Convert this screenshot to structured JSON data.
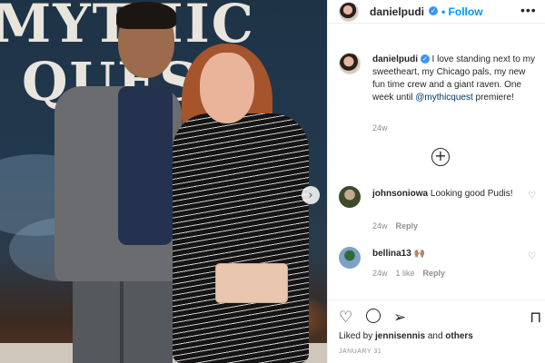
{
  "photo": {
    "poster_line1": "MYTHIC",
    "poster_line2": "QUEST",
    "next_glyph": "›"
  },
  "header": {
    "username": "danielpudi",
    "verified_glyph": "✓",
    "dot": "•",
    "follow_label": "Follow",
    "more_glyph": "•••"
  },
  "caption": {
    "username": "danielpudi",
    "text": " I love standing next to my sweetheart, my Chicago pals, my new fun time crew and a giant raven. One week until ",
    "mention": "@mythicquest",
    "text_end": " premiere!",
    "time": "24w"
  },
  "load_more_glyph": "+",
  "comments": [
    {
      "username": "johnsoniowa",
      "text": " Looking good Pudis!",
      "time": "24w",
      "likes": "",
      "reply": "Reply"
    },
    {
      "username": "bellina13",
      "text": " 🙌🏽",
      "time": "24w",
      "likes": "1 like",
      "reply": "Reply"
    }
  ],
  "actions": {
    "liked_by_prefix": "Liked by ",
    "liked_by_user": "jennisennis",
    "liked_by_mid": " and ",
    "liked_by_others": "others",
    "date": "JANUARY 31"
  },
  "icons": {
    "heart": "heart-icon",
    "comment": "comment-icon",
    "share": "share-icon",
    "save": "bookmark-icon"
  },
  "colors": {
    "link": "#0095f6",
    "verified": "#3897f0",
    "muted": "#8e8e8e"
  }
}
